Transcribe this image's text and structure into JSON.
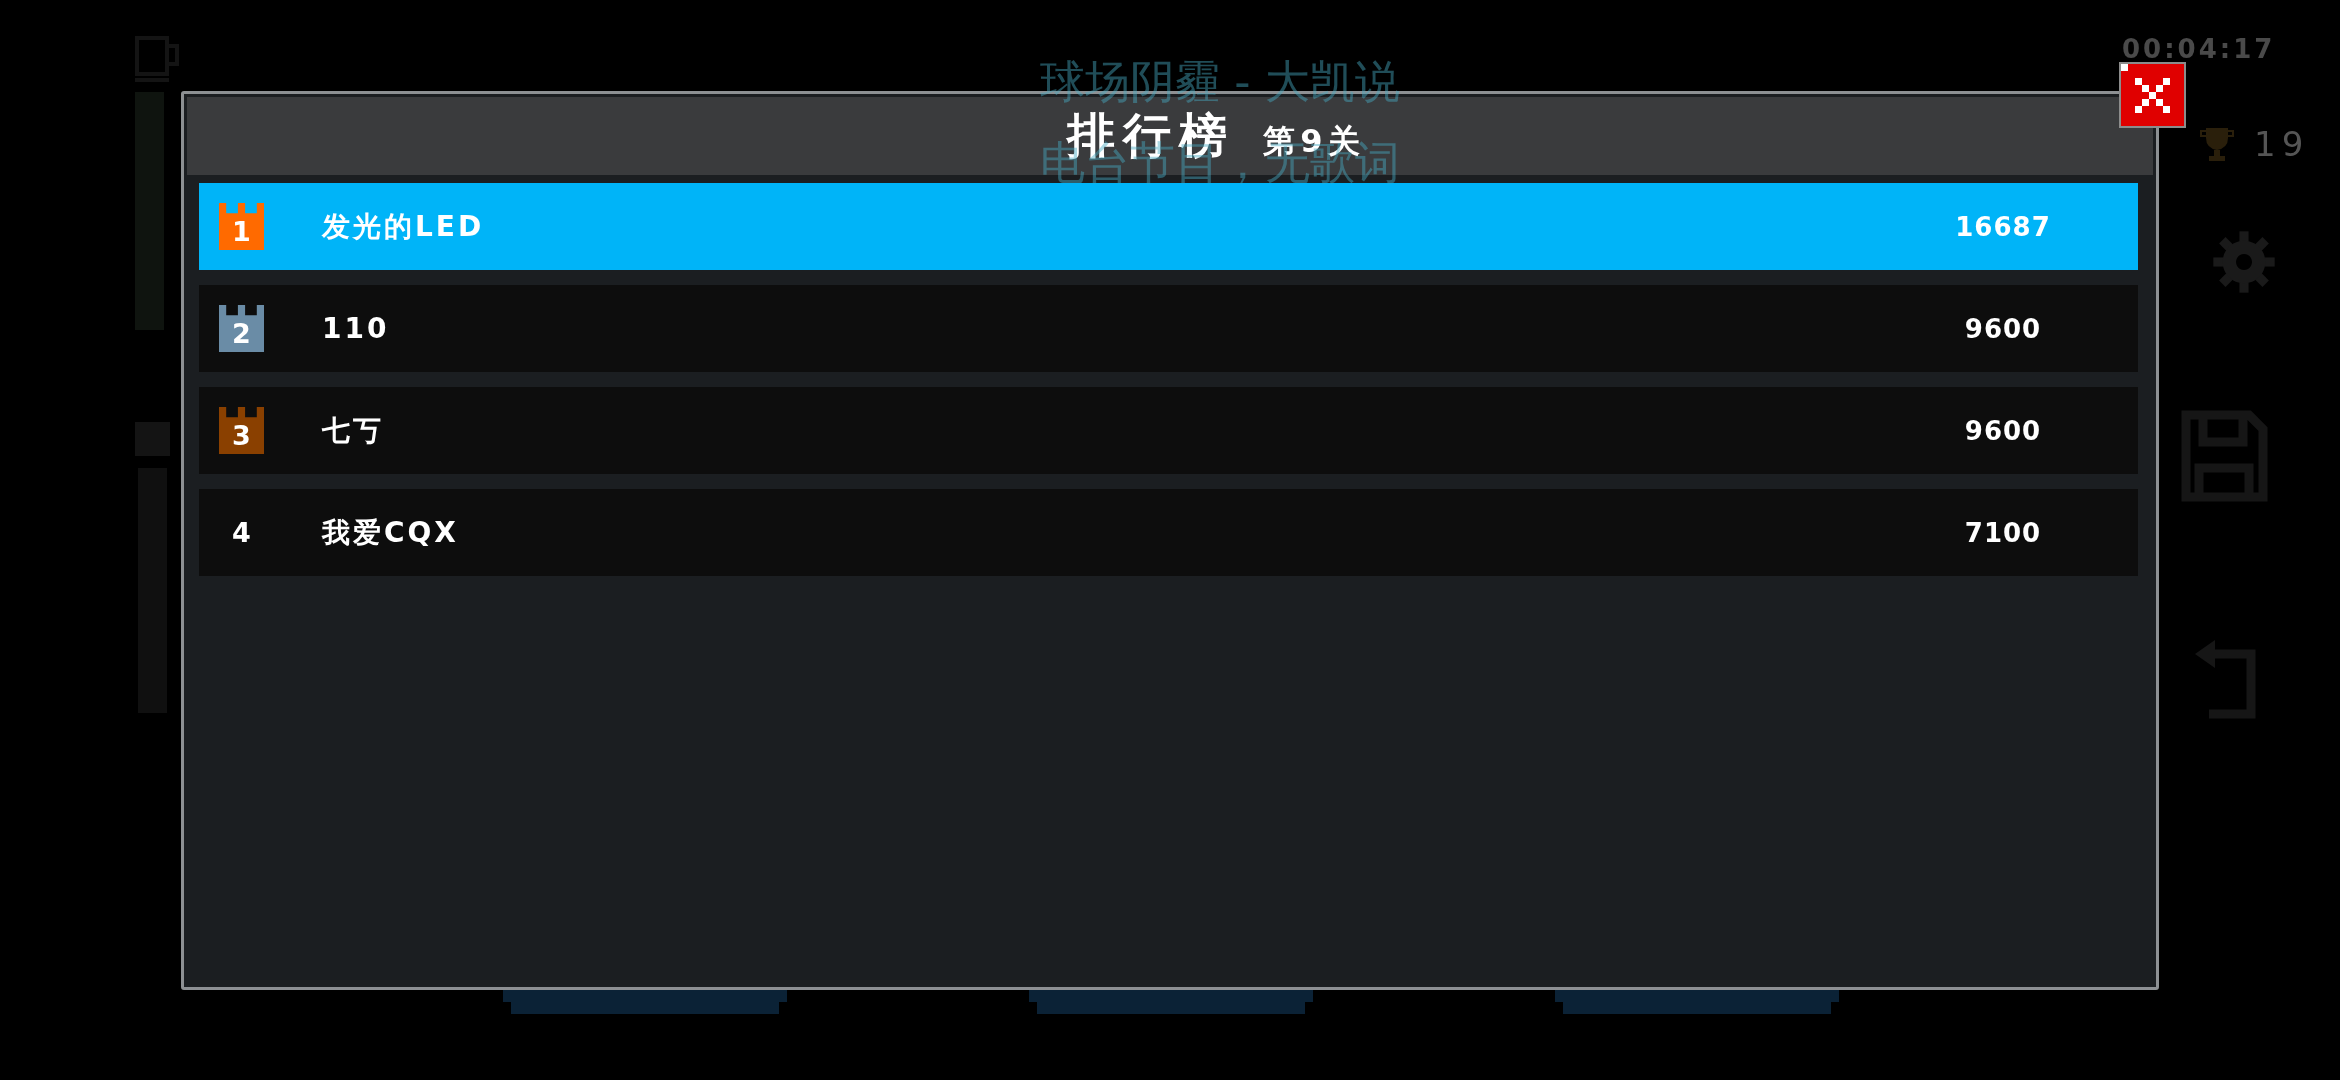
{
  "game_background": {
    "timer": "00:04:17",
    "trophy_count": "19"
  },
  "dialog": {
    "title": "排行榜",
    "level": "第9关",
    "rows": [
      {
        "kind": "crown",
        "color": "#ff6a00",
        "rank": "1",
        "name": "发光的LED",
        "score": "16687",
        "highlighted": true
      },
      {
        "kind": "crown",
        "color": "#6a8ca6",
        "rank": "2",
        "name": "110",
        "score": "9600",
        "highlighted": false
      },
      {
        "kind": "crown",
        "color": "#8a4000",
        "rank": "3",
        "name": "七丂",
        "score": "9600",
        "highlighted": false
      },
      {
        "kind": "number",
        "rank": "4",
        "name": "我爱CQX",
        "score": "7100",
        "highlighted": false
      }
    ]
  },
  "lyrics_overlay": {
    "lines": [
      "球场阴霾 - 大凯说",
      "电台节目，无歌词"
    ]
  }
}
